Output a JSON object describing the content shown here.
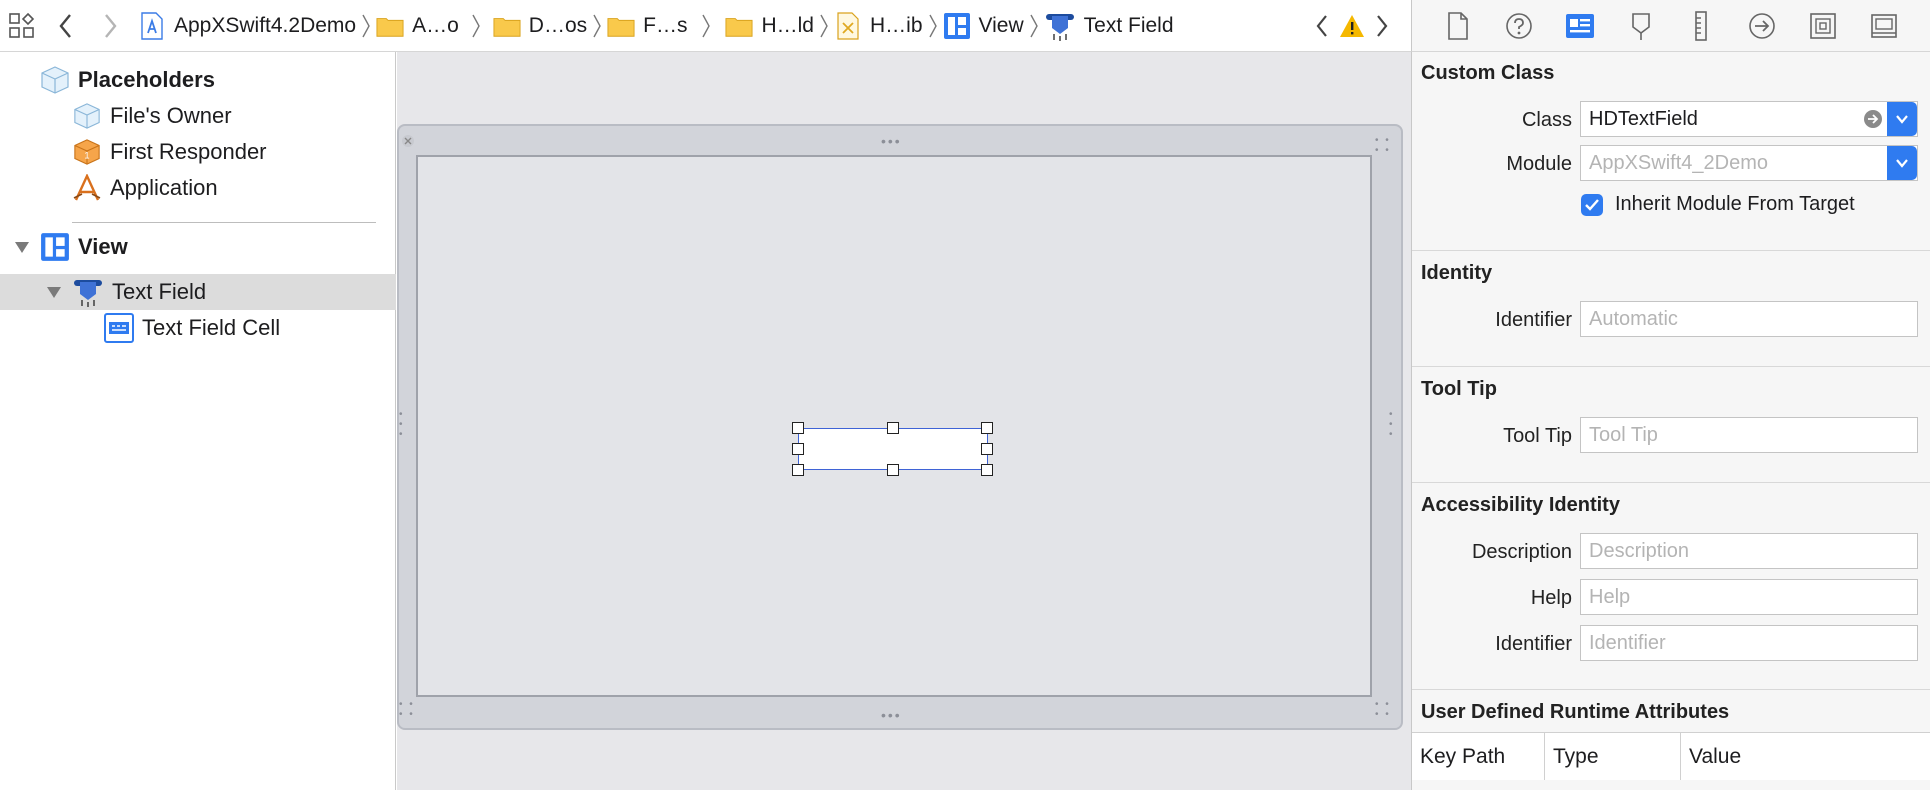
{
  "jumpbar": {
    "project": "AppXSwift4.2Demo",
    "crumbs": [
      "A…o",
      "D…os",
      "F…s",
      "H…ld",
      "H…ib",
      "View",
      "Text Field"
    ]
  },
  "outline": {
    "placeholders_label": "Placeholders",
    "files_owner": "File's Owner",
    "first_responder": "First Responder",
    "application": "Application",
    "view": "View",
    "text_field": "Text Field",
    "text_field_cell": "Text Field Cell"
  },
  "inspector": {
    "custom_class": {
      "title": "Custom Class",
      "class_label": "Class",
      "class_value": "HDTextField",
      "module_label": "Module",
      "module_placeholder": "AppXSwift4_2Demo",
      "inherit_label": "Inherit Module From Target",
      "inherit_checked": true
    },
    "identity": {
      "title": "Identity",
      "identifier_label": "Identifier",
      "identifier_placeholder": "Automatic"
    },
    "tooltip": {
      "title": "Tool Tip",
      "label": "Tool Tip",
      "placeholder": "Tool Tip"
    },
    "accessibility": {
      "title": "Accessibility Identity",
      "description_label": "Description",
      "description_placeholder": "Description",
      "help_label": "Help",
      "help_placeholder": "Help",
      "identifier_label": "Identifier",
      "identifier_placeholder": "Identifier"
    },
    "runtime_attributes": {
      "title": "User Defined Runtime Attributes",
      "columns": [
        "Key Path",
        "Type",
        "Value"
      ]
    }
  },
  "colors": {
    "accent": "#2f7bf0",
    "selection_row": "#dcdcdc",
    "warning": "#f5b800"
  }
}
